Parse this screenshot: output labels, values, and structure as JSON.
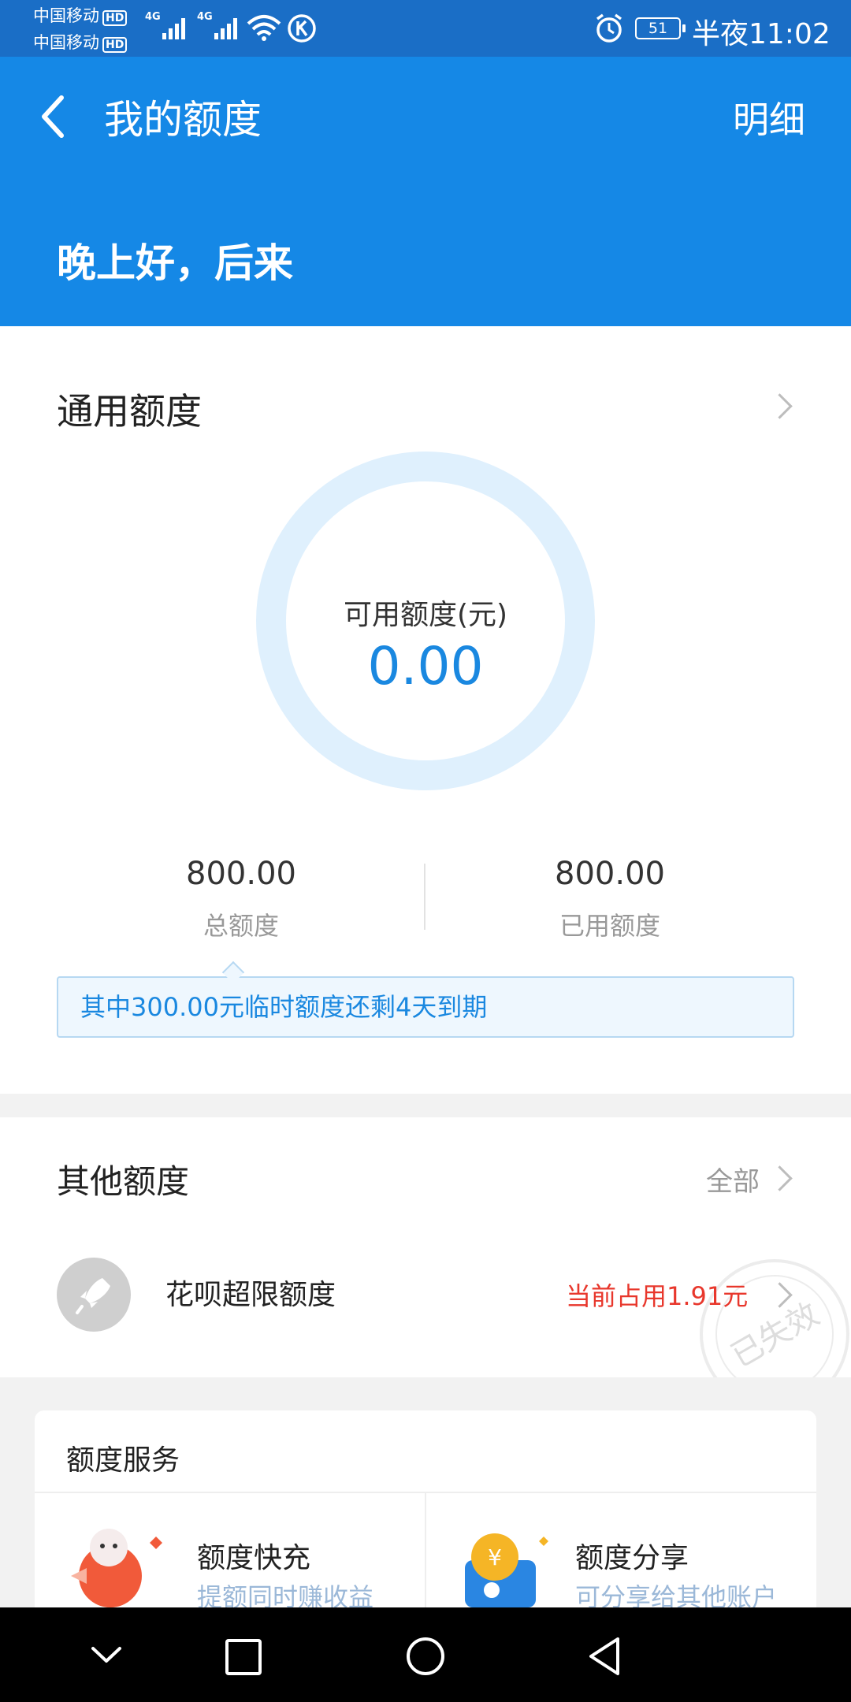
{
  "status_bar": {
    "carrier1": "中国移动",
    "carrier2": "中国移动",
    "hd": "HD",
    "network": "4G",
    "battery": "51",
    "time": "半夜11:02"
  },
  "header": {
    "title": "我的额度",
    "detail_label": "明细",
    "greeting": "晚上好，后来"
  },
  "general_quota": {
    "title": "通用额度",
    "available_label": "可用额度(元)",
    "available_value": "0.00",
    "total_value": "800.00",
    "total_label": "总额度",
    "used_value": "800.00",
    "used_label": "已用额度",
    "notice": "其中300.00元临时额度还剩4天到期"
  },
  "other_quota": {
    "title": "其他额度",
    "all_label": "全部",
    "item_name": "花呗超限额度",
    "item_status": "当前占用1.91元",
    "item_status_color": "#e8372c",
    "stamp_text": "已失效"
  },
  "services": {
    "title": "额度服务",
    "items": [
      {
        "name": "额度快充",
        "desc": "提额同时赚收益"
      },
      {
        "name": "额度分享",
        "desc": "可分享给其他账户"
      }
    ]
  },
  "colors": {
    "brand": "#1588e6",
    "accent": "#1a88e0"
  }
}
